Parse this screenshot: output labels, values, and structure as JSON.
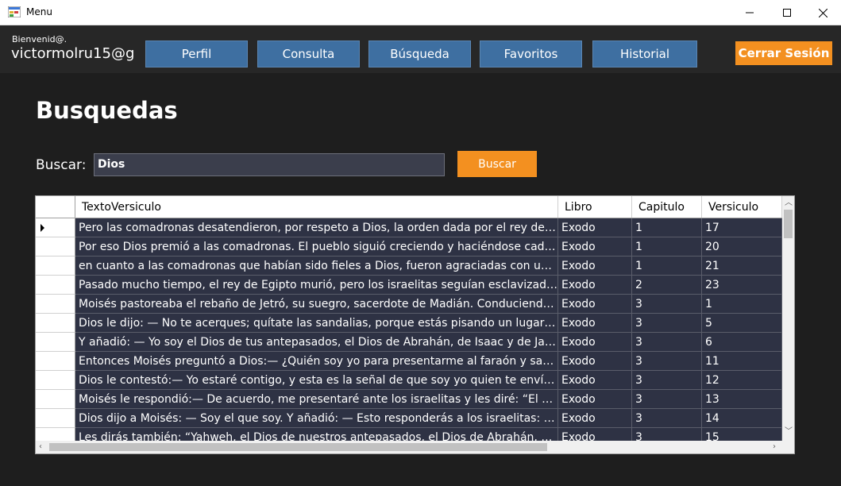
{
  "window": {
    "title": "Menu"
  },
  "header": {
    "welcome": "Bienvenid@.",
    "user": "victormolru15@g",
    "nav": [
      "Perfil",
      "Consulta",
      "Búsqueda",
      "Favoritos",
      "Historial"
    ],
    "logout": "Cerrar Sesión"
  },
  "page": {
    "title": "Busquedas"
  },
  "search": {
    "label": "Buscar:",
    "value": "Dios",
    "button": "Buscar"
  },
  "grid": {
    "columns": [
      "TextoVersiculo",
      "Libro",
      "Capitulo",
      "Versiculo"
    ],
    "rows": [
      {
        "texto": "Pero las comadronas desatendieron, por respeto a Dios, la orden dada por el rey de E...",
        "libro": "Exodo",
        "capitulo": "1",
        "versiculo": "17"
      },
      {
        "texto": "Por eso Dios premió a las comadronas. El pueblo siguió creciendo y haciéndose cada ...",
        "libro": "Exodo",
        "capitulo": "1",
        "versiculo": "20"
      },
      {
        "texto": "en cuanto a las comadronas que habían sido fieles a Dios, fueron agraciadas con una ...",
        "libro": "Exodo",
        "capitulo": "1",
        "versiculo": "21"
      },
      {
        "texto": "Pasado mucho tiempo, el rey de Egipto murió, pero los israelitas seguían esclavizado...",
        "libro": "Exodo",
        "capitulo": "2",
        "versiculo": "23"
      },
      {
        "texto": "Moisés pastoreaba el rebaño de Jetró, su suegro, sacerdote de Madián. Conduciendo ...",
        "libro": "Exodo",
        "capitulo": "3",
        "versiculo": "1"
      },
      {
        "texto": "Dios le dijo: — No te acerques; quítate las sandalias, porque estás pisando un lugar s...",
        "libro": "Exodo",
        "capitulo": "3",
        "versiculo": "5"
      },
      {
        "texto": "Y añadió: — Yo soy el Dios de tus antepasados, el Dios de Abrahán, de Isaac y de Jaco...",
        "libro": "Exodo",
        "capitulo": "3",
        "versiculo": "6"
      },
      {
        "texto": "Entonces Moisés preguntó a Dios:— ¿Quién soy yo para presentarme al faraón y sac...",
        "libro": "Exodo",
        "capitulo": "3",
        "versiculo": "11"
      },
      {
        "texto": "Dios le contestó:— Yo estaré contigo, y esta es la señal de que soy yo quien te envía: ...",
        "libro": "Exodo",
        "capitulo": "3",
        "versiculo": "12"
      },
      {
        "texto": "Moisés le respondió:— De acuerdo, me presentaré ante los israelitas y les diré: “El Di...",
        "libro": "Exodo",
        "capitulo": "3",
        "versiculo": "13"
      },
      {
        "texto": "Dios dijo a Moisés: — Soy el que soy. Y añadió: — Esto responderás a los israelitas: “...",
        "libro": "Exodo",
        "capitulo": "3",
        "versiculo": "14"
      },
      {
        "texto": "Les dirás también: “Yahweh, el Dios de nuestros antepasados, el Dios de Abrahán, de...",
        "libro": "Exodo",
        "capitulo": "3",
        "versiculo": "15"
      }
    ]
  }
}
